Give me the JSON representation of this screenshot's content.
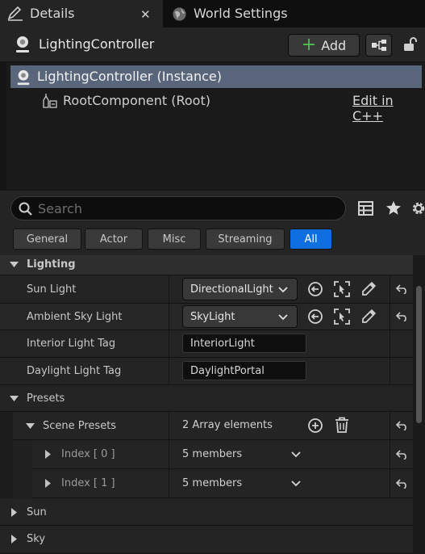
{
  "tabs": [
    {
      "label": "Details"
    },
    {
      "label": "World Settings"
    }
  ],
  "header": {
    "title": "LightingController",
    "add_label": "Add"
  },
  "tree": [
    {
      "label": "LightingController (Instance)"
    },
    {
      "label": "RootComponent (Root)",
      "link": "Edit in C++"
    }
  ],
  "search": {
    "placeholder": "Search"
  },
  "filters": [
    {
      "label": "General"
    },
    {
      "label": "Actor"
    },
    {
      "label": "Misc"
    },
    {
      "label": "Streaming"
    },
    {
      "label": "All"
    }
  ],
  "sections": {
    "lighting": "Lighting",
    "presets": "Presets",
    "sun": "Sun",
    "sky": "Sky"
  },
  "props": {
    "sun_light": {
      "name": "Sun Light",
      "value": "DirectionalLight"
    },
    "ambient_sky": {
      "name": "Ambient Sky Light",
      "value": "SkyLight"
    },
    "interior_tag": {
      "name": "Interior Light Tag",
      "value": "InteriorLight"
    },
    "daylight_tag": {
      "name": "Daylight Light Tag",
      "value": "DaylightPortal"
    },
    "scene_presets": {
      "name": "Scene Presets",
      "value": "2 Array elements"
    },
    "index0": {
      "name": "Index [ 0 ]",
      "value": "5 members"
    },
    "index1": {
      "name": "Index [ 1 ]",
      "value": "5 members"
    }
  },
  "colors": {
    "accent": "#0f6fe0",
    "selection": "#58657a",
    "add_green": "#4cc24c"
  }
}
